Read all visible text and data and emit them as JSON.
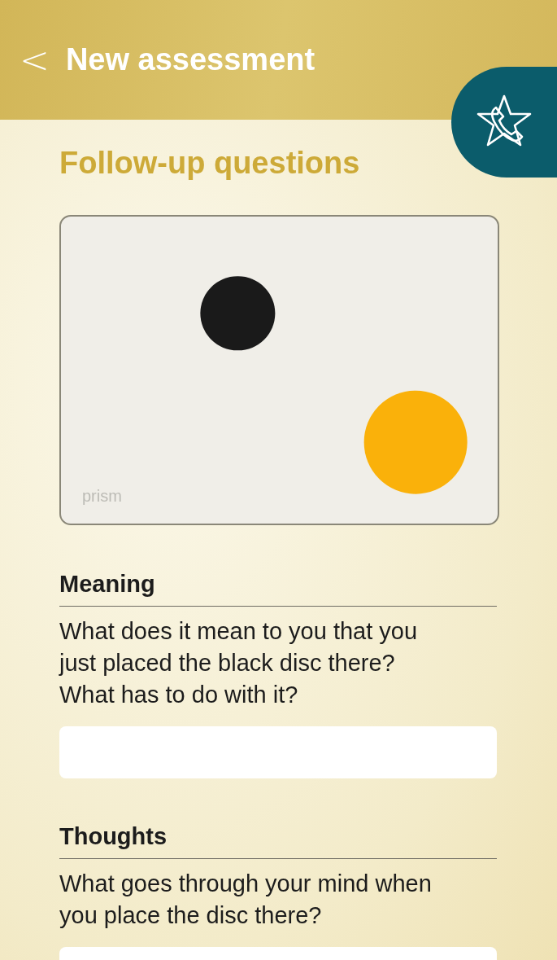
{
  "header": {
    "back_icon": "<",
    "title": "New assessment"
  },
  "heading": "Follow-up questions",
  "board": {
    "logo": "prism",
    "discs": [
      {
        "color": "#1a1a1a"
      },
      {
        "color": "#fab10a"
      }
    ]
  },
  "questions": [
    {
      "title": "Meaning",
      "text": "What does it mean to you that you just placed the black disc there? What has to do with it?"
    },
    {
      "title": "Thoughts",
      "text": "What goes through your mind when you place the disc there?"
    }
  ]
}
